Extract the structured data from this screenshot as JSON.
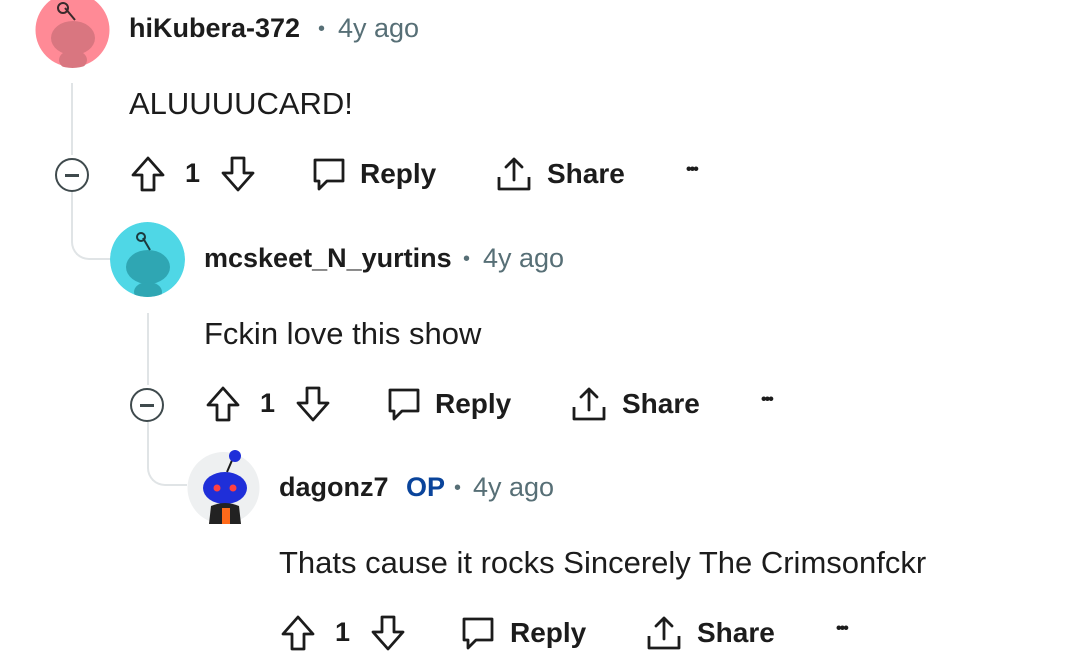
{
  "comments": [
    {
      "username": "hiKubera-372",
      "separator": "•",
      "age": "4y ago",
      "body": "ALUUUUCARD!",
      "votes": "1",
      "avatar_color": "#ff8a96"
    },
    {
      "username": "mcskeet_N_yurtins",
      "separator": "•",
      "age": "4y ago",
      "body": "Fckin love this show",
      "votes": "1",
      "avatar_color": "#4fd7e6"
    },
    {
      "username": "dagonz7",
      "op_badge": "OP",
      "separator": "•",
      "age": "4y ago",
      "body": "Thats cause it rocks Sincerely The Crimsonfckr",
      "votes": "1",
      "avatar_color": "#1f2fd9"
    }
  ],
  "actions": {
    "reply_label": "Reply",
    "share_label": "Share",
    "more_label": "•••"
  },
  "icons": [
    "upvote-icon",
    "downvote-icon",
    "reply-icon",
    "share-icon",
    "collapse-icon",
    "more-icon"
  ],
  "colors": {
    "meta_text": "#576f76",
    "op_badge": "#0a449b",
    "thread_line": "#e0e4e6"
  }
}
